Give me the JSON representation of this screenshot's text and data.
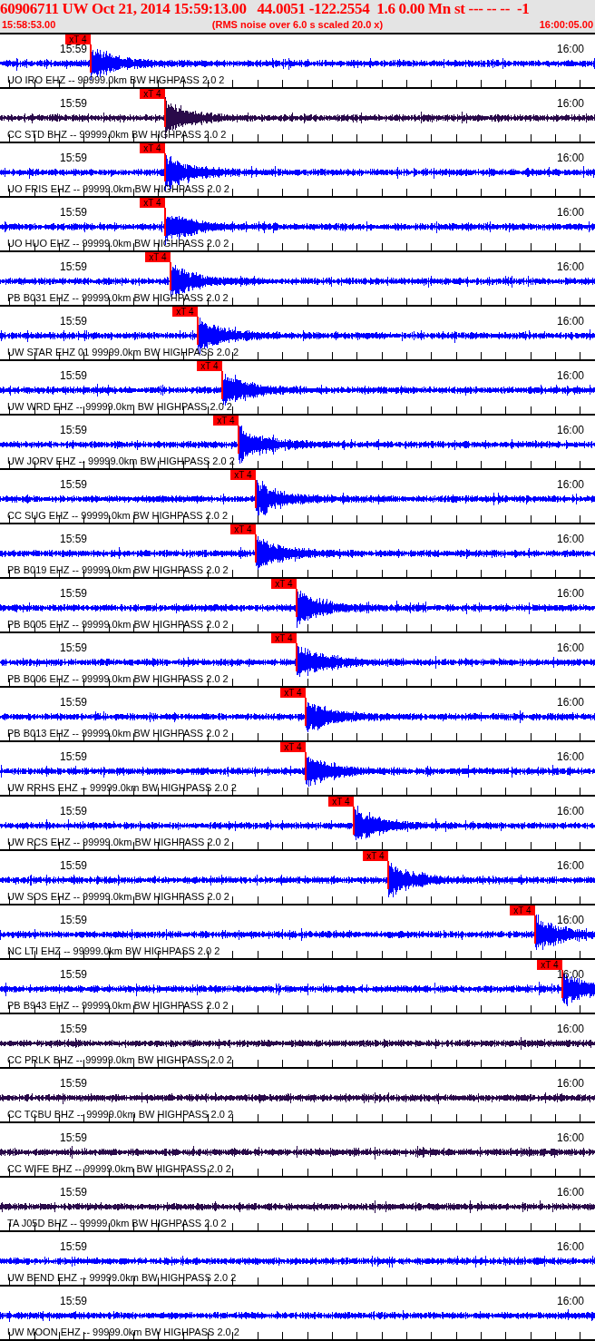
{
  "event_header": {
    "title": "60906711 UW Oct 21, 2014 15:59:13.00   44.0051 -122.2554  1.6 0.00 Mn st --- -- --  -1",
    "start_time": "15:58:53.00",
    "note": "(RMS noise over 6.0 s scaled 20.0 x)",
    "end_time": "16:00:05.00"
  },
  "traces": [
    {
      "station": "UO IRO EHZ -- 99999.0km BW HIGHPASS 2.0 2",
      "start_tick": "15:59",
      "end_tick": "16:00",
      "color": "#0000ff",
      "pick": {
        "label": "xT 4",
        "level": 0.152
      }
    },
    {
      "station": "CC STD BHZ -- 99999.0km BW HIGHPASS 2.0 2",
      "start_tick": "15:59",
      "end_tick": "16:00",
      "color": "#2a0a4a",
      "pick": {
        "label": "xT 4",
        "level": 0.277
      }
    },
    {
      "station": "UO FRIS EHZ -- 99999.0km BW HIGHPASS 2.0 2",
      "start_tick": "15:59",
      "end_tick": "16:00",
      "color": "#0000ff",
      "pick": {
        "label": "xT 4",
        "level": 0.277
      }
    },
    {
      "station": "UO HUO EHZ -- 99999.0km BW HIGHPASS 2.0 2",
      "start_tick": "15:59",
      "end_tick": "16:00",
      "color": "#0000ff",
      "pick": {
        "label": "xT 4",
        "level": 0.277
      }
    },
    {
      "station": "PB B031 EHZ -- 99999.0km BW HIGHPASS 2.0 2",
      "start_tick": "15:59",
      "end_tick": "16:00",
      "color": "#0000ff",
      "pick": {
        "label": "xT 4",
        "level": 0.287
      }
    },
    {
      "station": "UW STAR EHZ 01 99999.0km BW HIGHPASS 2.0 2",
      "start_tick": "15:59",
      "end_tick": "16:00",
      "color": "#0000ff",
      "pick": {
        "label": "xT 4",
        "level": 0.332
      }
    },
    {
      "station": "UW WRD EHZ -- 99999.0km BW HIGHPASS 2.0 2",
      "start_tick": "15:59",
      "end_tick": "16:00",
      "color": "#0000ff",
      "pick": {
        "label": "xT 4",
        "level": 0.373
      }
    },
    {
      "station": "UW JORV EHZ -- 99999.0km BW HIGHPASS 2.0 2",
      "start_tick": "15:59",
      "end_tick": "16:00",
      "color": "#0000ff",
      "pick": {
        "label": "xT 4",
        "level": 0.401
      }
    },
    {
      "station": "CC SUG EHZ -- 99999.0km BW HIGHPASS 2.0 2",
      "start_tick": "15:59",
      "end_tick": "16:00",
      "color": "#0000ff",
      "pick": {
        "label": "xT 4",
        "level": 0.43
      }
    },
    {
      "station": "PB B019 EHZ -- 99999.0km BW HIGHPASS 2.0 2",
      "start_tick": "15:59",
      "end_tick": "16:00",
      "color": "#0000ff",
      "pick": {
        "label": "xT 4",
        "level": 0.43
      }
    },
    {
      "station": "PB B005 EHZ -- 99999.0km BW HIGHPASS 2.0 2",
      "start_tick": "15:59",
      "end_tick": "16:00",
      "color": "#0000ff",
      "pick": {
        "label": "xT 4",
        "level": 0.498
      }
    },
    {
      "station": "PB B006 EHZ -- 99999.0km BW HIGHPASS 2.0 2",
      "start_tick": "15:59",
      "end_tick": "16:00",
      "color": "#0000ff",
      "pick": {
        "label": "xT 4",
        "level": 0.498
      }
    },
    {
      "station": "PB B013 EHZ -- 99999.0km BW HIGHPASS 2.0 2",
      "start_tick": "15:59",
      "end_tick": "16:00",
      "color": "#0000ff",
      "pick": {
        "label": "xT 4",
        "level": 0.514
      }
    },
    {
      "station": "UW RRHS EHZ -- 99999.0km BW HIGHPASS 2.0 2",
      "start_tick": "15:59",
      "end_tick": "16:00",
      "color": "#0000ff",
      "pick": {
        "label": "xT 4",
        "level": 0.514
      }
    },
    {
      "station": "UW RCS EHZ -- 99999.0km BW HIGHPASS 2.0 2",
      "start_tick": "15:59",
      "end_tick": "16:00",
      "color": "#0000ff",
      "pick": {
        "label": "xT 4",
        "level": 0.595
      }
    },
    {
      "station": "UW SOS EHZ -- 99999.0km BW HIGHPASS 2.0 2",
      "start_tick": "15:59",
      "end_tick": "16:00",
      "color": "#0000ff",
      "pick": {
        "label": "xT 4",
        "level": 0.652
      }
    },
    {
      "station": "NC LTI EHZ -- 99999.0km BW HIGHPASS 2.0 2",
      "start_tick": "15:59",
      "end_tick": "16:00",
      "color": "#0000ff",
      "pick": {
        "label": "xT 4",
        "level": 0.899
      }
    },
    {
      "station": "PB B943 EHZ -- 99999.0km BW HIGHPASS 2.0 2",
      "start_tick": "15:59",
      "end_tick": "16:00",
      "color": "#0000ff",
      "pick": {
        "label": "xT 4",
        "level": 0.945
      }
    },
    {
      "station": "CC PRLK BHZ -- 99999.0km BW HIGHPASS 2.0 2",
      "start_tick": "15:59",
      "end_tick": "16:00",
      "color": "#2a0a4a"
    },
    {
      "station": "CC TCBU BHZ -- 99999.0km BW HIGHPASS 2.0 2",
      "start_tick": "15:59",
      "end_tick": "16:00",
      "color": "#2a0a4a"
    },
    {
      "station": "CC WIFE BHZ -- 99999.0km BW HIGHPASS 2.0 2",
      "start_tick": "15:59",
      "end_tick": "16:00",
      "color": "#2a0a4a"
    },
    {
      "station": "TA J05D BHZ -- 99999.0km BW HIGHPASS 2.0 2",
      "start_tick": "15:59",
      "end_tick": "16:00",
      "color": "#2a0a4a"
    },
    {
      "station": "UW BEND EHZ -- 99999.0km BW HIGHPASS 2.0 2",
      "start_tick": "15:59",
      "end_tick": "16:00",
      "color": "#0000ff"
    },
    {
      "station": "UW MOON EHZ -- 99999.0km BW HIGHPASS 2.0 2",
      "start_tick": "15:59",
      "end_tick": "16:00",
      "color": "#0000ff"
    }
  ]
}
